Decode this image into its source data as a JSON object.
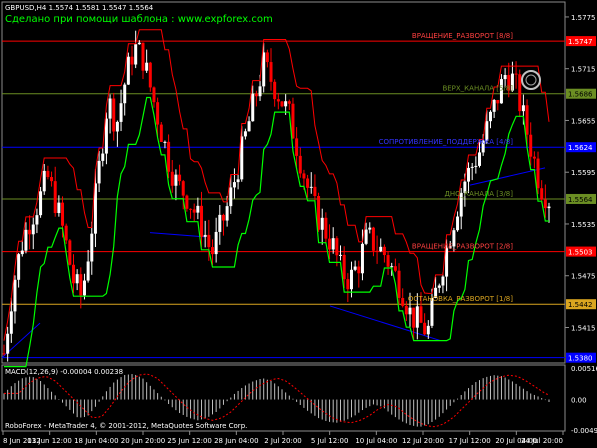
{
  "symbol_header": "GBPUSD,H4  1.5574 1.5581 1.5547 1.5564",
  "watermark": "Сделано при помощи шаблона : www.expforex.com",
  "indicator_header": "MACD(12,26,9) -0.00004 0.00238",
  "copyright": "RoboForex - MetaTrader 4, © 2001-2012, MetaQuotes Software Corp.",
  "colors": {
    "background": "#000000",
    "bull_candle": "#ffffff",
    "bear_candle": "#ff0000",
    "green_line": "#00ff00",
    "red_line": "#ff0000",
    "blue_line": "#0000ff",
    "price_axis_text": "#ffffff",
    "watermark": "#00ff00"
  },
  "price_axis": {
    "labels": [
      "1.5775",
      "1.5715",
      "1.5655",
      "1.5595",
      "1.5535",
      "1.5475",
      "1.5415"
    ]
  },
  "murrey_levels": [
    {
      "name": "ВРАЩЕНИЕ_РАЗВОРОТ [8/8]",
      "value": "1.5747",
      "color": "#ff0000",
      "text_color": "#ff4040"
    },
    {
      "name": "ВЕРХ_КАНАЛА [5/8]",
      "value": "1.5686",
      "color": "#6b8e23",
      "text_color": "#6b8e23"
    },
    {
      "name": "СОПРОТИВЛЕНИЕ_ПОДДЕРЖКА [4/8]",
      "value": "1.5624",
      "color": "#0000ff",
      "text_color": "#3333ff"
    },
    {
      "name": "ДНО_КАНАЛА [3/8]",
      "value": "1.5564",
      "color": "#6b8e23",
      "text_color": "#6b8e23"
    },
    {
      "name": "ВРАЩЕНИЕ_РАЗВОРОТ [2/8]",
      "value": "1.5503",
      "color": "#ff0000",
      "text_color": "#ff4040"
    },
    {
      "name": "ОСТАНОВКА_РАЗВОРОТ [1/8]",
      "value": "1.5442",
      "color": "#daa520",
      "text_color": "#daa520"
    },
    {
      "name": "",
      "value": "1.5380",
      "color": "#0000ff",
      "text_color": "#3333ff"
    }
  ],
  "macd_axis": {
    "labels": [
      "0.00516",
      "0.00",
      "-0.00498"
    ]
  },
  "time_axis": {
    "labels": [
      "8 Jun 2012",
      "13 Jun 12:00",
      "18 Jun 04:00",
      "20 Jun 20:00",
      "25 Jun 12:00",
      "28 Jun 04:00",
      "2 Jul 20:00",
      "5 Jul 12:00",
      "10 Jul 04:00",
      "12 Jul 20:00",
      "17 Jul 12:00",
      "20 Jul 04:00",
      "24 Jul 20:00"
    ]
  },
  "chart_data": {
    "type": "candlestick",
    "symbol": "GBPUSD",
    "timeframe": "H4",
    "ohlc_last": {
      "open": 1.5574,
      "high": 1.5581,
      "low": 1.5547,
      "close": 1.5564
    },
    "ylim": [
      1.5375,
      1.579
    ],
    "close_path": [
      1.5385,
      1.546,
      1.551,
      1.554,
      1.556,
      1.559,
      1.556,
      1.552,
      1.547,
      1.545,
      1.552,
      1.56,
      1.568,
      1.565,
      1.57,
      1.574,
      1.573,
      1.569,
      1.565,
      1.561,
      1.558,
      1.557,
      1.555,
      1.553,
      1.55,
      1.553,
      1.556,
      1.56,
      1.564,
      1.568,
      1.572,
      1.57,
      1.568,
      1.566,
      1.562,
      1.558,
      1.555,
      1.553,
      1.551,
      1.548,
      1.547,
      1.549,
      1.552,
      1.551,
      1.55,
      1.548,
      1.546,
      1.543,
      1.542,
      1.541,
      1.546,
      1.55,
      1.554,
      1.558,
      1.56,
      1.562,
      1.565,
      1.568,
      1.571,
      1.57,
      1.566,
      1.562,
      1.558,
      1.5564
    ],
    "macd": [
      0.001,
      0.0025,
      0.0035,
      0.0038,
      0.003,
      0.0015,
      0.0,
      -0.0015,
      -0.003,
      -0.0028,
      -0.001,
      0.0012,
      0.003,
      0.004,
      0.0042,
      0.0035,
      0.002,
      0.0005,
      -0.001,
      -0.0022,
      -0.003,
      -0.0034,
      -0.003,
      -0.002,
      -0.0005,
      0.001,
      0.0022,
      0.003,
      0.0035,
      0.003,
      0.0018,
      0.0005,
      -0.0008,
      -0.002,
      -0.003,
      -0.0036,
      -0.0038,
      -0.0034,
      -0.0026,
      -0.0015,
      -0.0008,
      -0.0012,
      -0.0025,
      -0.0035,
      -0.0042,
      -0.0045,
      -0.004,
      -0.003,
      -0.0015,
      0.0,
      0.0015,
      0.0028,
      0.0036,
      0.004,
      0.0038,
      0.003,
      0.002,
      0.001,
      0.0004,
      -0.0004
    ]
  }
}
